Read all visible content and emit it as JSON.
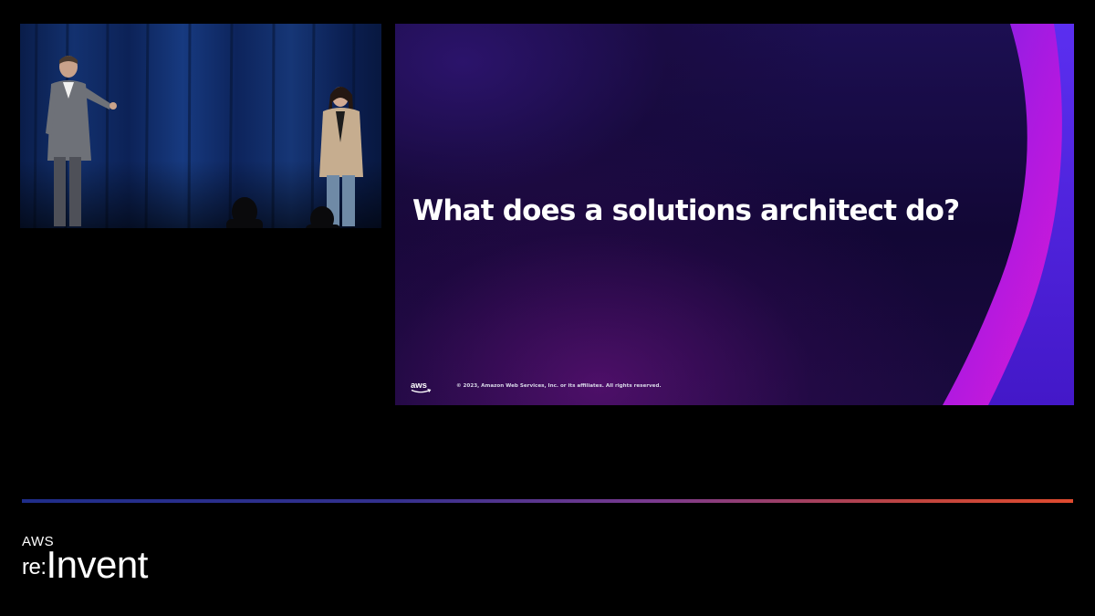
{
  "slide": {
    "title": "What does a solutions architect do?",
    "footer_logo": "aws",
    "copyright": "© 2023, Amazon Web Services, Inc. or its affiliates. All rights reserved."
  },
  "event_logo": {
    "brand": "AWS",
    "prefix": "re:",
    "name": "Invent"
  },
  "colors": {
    "slide_background": "#160a45",
    "swoosh_magenta": "#c21adf",
    "swoosh_purple": "#6a1fe0",
    "divider_start": "#1f2d8a",
    "divider_end": "#e04b2f"
  },
  "video": {
    "subject": "two presenters on stage"
  }
}
